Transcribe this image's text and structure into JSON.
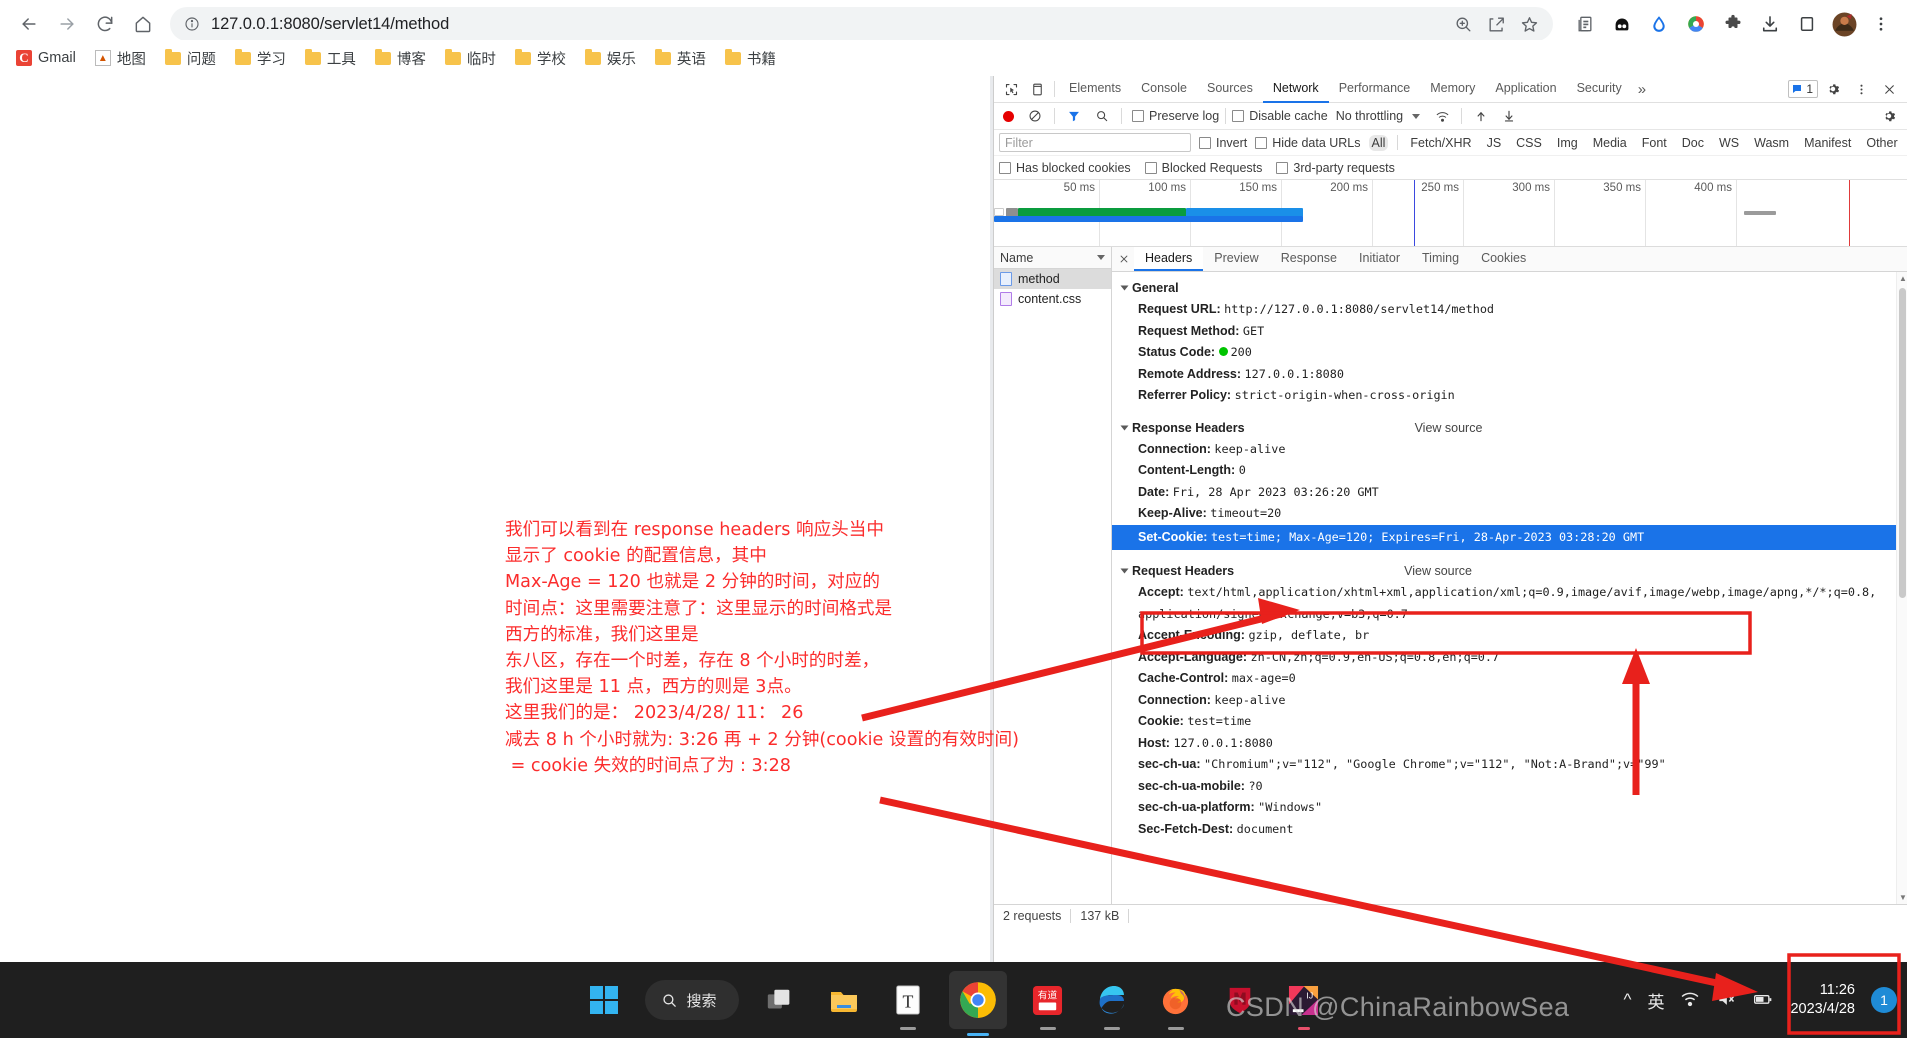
{
  "browser": {
    "url": "127.0.0.1:8080/servlet14/method",
    "nav_icons": [
      "back-icon",
      "forward-icon",
      "reload-icon",
      "home-icon"
    ],
    "omnibox_actions": [
      "zoom-icon",
      "share-icon",
      "bookmark-star-icon"
    ],
    "toolbar_icons": [
      "reading-list-icon",
      "extension-dark-icon",
      "drop-icon",
      "color-circle-icon",
      "puzzle-extensions-icon",
      "downloads-icon",
      "sidepanel-icon",
      "profile-avatar",
      "chrome-menu-icon"
    ],
    "bookmarks": [
      {
        "label": "Gmail",
        "icon": "gmail-icon"
      },
      {
        "label": "地图",
        "icon": "maps-icon"
      },
      {
        "label": "问题",
        "icon": "folder-icon"
      },
      {
        "label": "学习",
        "icon": "folder-icon"
      },
      {
        "label": "工具",
        "icon": "folder-icon"
      },
      {
        "label": "博客",
        "icon": "folder-icon"
      },
      {
        "label": "临时",
        "icon": "folder-icon"
      },
      {
        "label": "学校",
        "icon": "folder-icon"
      },
      {
        "label": "娱乐",
        "icon": "folder-icon"
      },
      {
        "label": "英语",
        "icon": "folder-icon"
      },
      {
        "label": "书籍",
        "icon": "folder-icon"
      }
    ]
  },
  "annotation": {
    "text": "我们可以看到在 response headers 响应头当中\n显示了 cookie 的配置信息，其中\nMax-Age = 120 也就是 2 分钟的时间，对应的\n时间点：这里需要注意了：这里显示的时间格式是\n西方的标准，我们这里是\n东八区，存在一个时差，存在 8 个小时的时差，\n我们这里是 11 点，西方的则是 3点。\n这里我们的是： 2023/4/28/ 11： 26\n减去 8 h 个小时就为: 3:26 再 + 2 分钟(cookie 设置的有效时间)\n = cookie 失效的时间点了为 : 3:28",
    "color": "#fb2c2c"
  },
  "devtools": {
    "tabs": [
      {
        "label": "Elements",
        "active": false
      },
      {
        "label": "Console",
        "active": false
      },
      {
        "label": "Sources",
        "active": false
      },
      {
        "label": "Network",
        "active": true
      },
      {
        "label": "Performance",
        "active": false
      },
      {
        "label": "Memory",
        "active": false
      },
      {
        "label": "Application",
        "active": false
      },
      {
        "label": "Security",
        "active": false
      }
    ],
    "more_tabs_label": "»",
    "issues_count": "1",
    "left_icons": [
      "inspect-element-icon",
      "device-toolbar-icon"
    ],
    "right_icons": [
      "issues-icon",
      "settings-gear-icon",
      "devtools-menu-icon",
      "close-devtools-icon"
    ],
    "network_toolbar": {
      "record_label": "record-button",
      "clear_label": "clear-button",
      "filter_label": "filter-button",
      "search_label": "search-button",
      "preserve_log": "Preserve log",
      "disable_cache": "Disable cache",
      "throttling": "No throttling",
      "import_label": "import-har-icon",
      "export_label": "export-har-icon",
      "settings_label": "network-settings-icon"
    },
    "filter_row": {
      "placeholder": "Filter",
      "invert": "Invert",
      "hide_data_urls": "Hide data URLs",
      "types": [
        "All",
        "Fetch/XHR",
        "JS",
        "CSS",
        "Img",
        "Media",
        "Font",
        "Doc",
        "WS",
        "Wasm",
        "Manifest",
        "Other"
      ],
      "selected_type": "All"
    },
    "cookie_row": {
      "has_blocked_cookies": "Has blocked cookies",
      "blocked_requests": "Blocked Requests",
      "third_party": "3rd-party requests"
    },
    "overview": {
      "ticks": [
        "50 ms",
        "100 ms",
        "150 ms",
        "200 ms",
        "250 ms",
        "300 ms",
        "350 ms",
        "400 ms"
      ]
    },
    "request_list": {
      "column_header": "Name",
      "rows": [
        {
          "name": "method",
          "icon": "document-file-icon",
          "selected": true
        },
        {
          "name": "content.css",
          "icon": "stylesheet-file-icon",
          "selected": false
        }
      ]
    },
    "detail_tabs": [
      {
        "label": "Headers",
        "active": true
      },
      {
        "label": "Preview",
        "active": false
      },
      {
        "label": "Response",
        "active": false
      },
      {
        "label": "Initiator",
        "active": false
      },
      {
        "label": "Timing",
        "active": false
      },
      {
        "label": "Cookies",
        "active": false
      }
    ],
    "sections": [
      {
        "title": "General",
        "view_source": "",
        "rows": [
          {
            "key": "Request URL:",
            "value": "http://127.0.0.1:8080/servlet14/method"
          },
          {
            "key": "Request Method:",
            "value": "GET"
          },
          {
            "key": "Status Code:",
            "value": "200",
            "status_dot": true
          },
          {
            "key": "Remote Address:",
            "value": "127.0.0.1:8080"
          },
          {
            "key": "Referrer Policy:",
            "value": "strict-origin-when-cross-origin"
          }
        ]
      },
      {
        "title": "Response Headers",
        "view_source": "View source",
        "rows": [
          {
            "key": "Connection:",
            "value": "keep-alive"
          },
          {
            "key": "Content-Length:",
            "value": "0"
          },
          {
            "key": "Date:",
            "value": "Fri, 28 Apr 2023 03:26:20 GMT"
          },
          {
            "key": "Keep-Alive:",
            "value": "timeout=20"
          },
          {
            "key": "Set-Cookie:",
            "value": "test=time; Max-Age=120; Expires=Fri, 28-Apr-2023 03:28:20 GMT",
            "highlight": true
          }
        ]
      },
      {
        "title": "Request Headers",
        "view_source": "View source",
        "rows": [
          {
            "key": "Accept:",
            "value": "text/html,application/xhtml+xml,application/xml;q=0.9,image/avif,image/webp,image/apng,*/*;q=0.8,application/signed-exchange;v=b3;q=0.7"
          },
          {
            "key": "Accept-Encoding:",
            "value": "gzip, deflate, br"
          },
          {
            "key": "Accept-Language:",
            "value": "zh-CN,zh;q=0.9,en-US;q=0.8,en;q=0.7"
          },
          {
            "key": "Cache-Control:",
            "value": "max-age=0"
          },
          {
            "key": "Connection:",
            "value": "keep-alive"
          },
          {
            "key": "Cookie:",
            "value": "test=time"
          },
          {
            "key": "Host:",
            "value": "127.0.0.1:8080"
          },
          {
            "key": "sec-ch-ua:",
            "value": "\"Chromium\";v=\"112\", \"Google Chrome\";v=\"112\", \"Not:A-Brand\";v=\"99\""
          },
          {
            "key": "sec-ch-ua-mobile:",
            "value": "?0"
          },
          {
            "key": "sec-ch-ua-platform:",
            "value": "\"Windows\""
          },
          {
            "key": "Sec-Fetch-Dest:",
            "value": "document"
          }
        ]
      }
    ],
    "status_bar": {
      "requests": "2 requests",
      "transferred": "137 kB"
    }
  },
  "taskbar": {
    "search_label": "搜索",
    "apps": [
      {
        "name": "start-button",
        "icon": "windows-logo-icon"
      },
      {
        "name": "task-view-button",
        "icon": "task-view-icon"
      },
      {
        "name": "file-explorer-button",
        "icon": "folder-icon"
      },
      {
        "name": "typora-button",
        "icon": "typora-icon"
      },
      {
        "name": "chrome-button",
        "icon": "chrome-icon"
      },
      {
        "name": "youdao-button",
        "icon": "youdao-icon"
      },
      {
        "name": "edge-button",
        "icon": "edge-icon"
      },
      {
        "name": "firefox-button",
        "icon": "firefox-icon"
      },
      {
        "name": "mcafee-button",
        "icon": "shield-icon"
      },
      {
        "name": "intellij-button",
        "icon": "intellij-idea-icon"
      }
    ],
    "tray": {
      "chevron": "^",
      "ime": "英",
      "icons": [
        "wifi-icon",
        "volume-mute-icon",
        "battery-icon"
      ],
      "time": "11:26",
      "date": "2023/4/28",
      "notification_count": "1"
    }
  },
  "watermark": "CSDN @ChinaRainbowSea"
}
